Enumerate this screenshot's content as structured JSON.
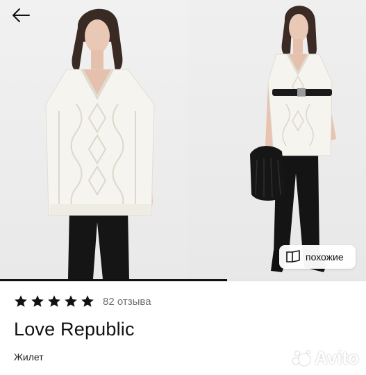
{
  "gallery": {
    "images": [
      {
        "alt": "model-front-view"
      },
      {
        "alt": "model-side-view-with-belt-and-bag"
      }
    ],
    "progress": 0.62
  },
  "similar_button": {
    "label": "похожие",
    "icon": "book-open-icon"
  },
  "rating": {
    "stars": 5,
    "max": 5,
    "reviews_label": "82 отзыва"
  },
  "product": {
    "brand": "Love Republic",
    "type": "Жилет"
  },
  "watermark": {
    "text": "Avito"
  },
  "colors": {
    "text": "#111111",
    "muted": "#707070",
    "star": "#111111",
    "background": "#ffffff"
  }
}
